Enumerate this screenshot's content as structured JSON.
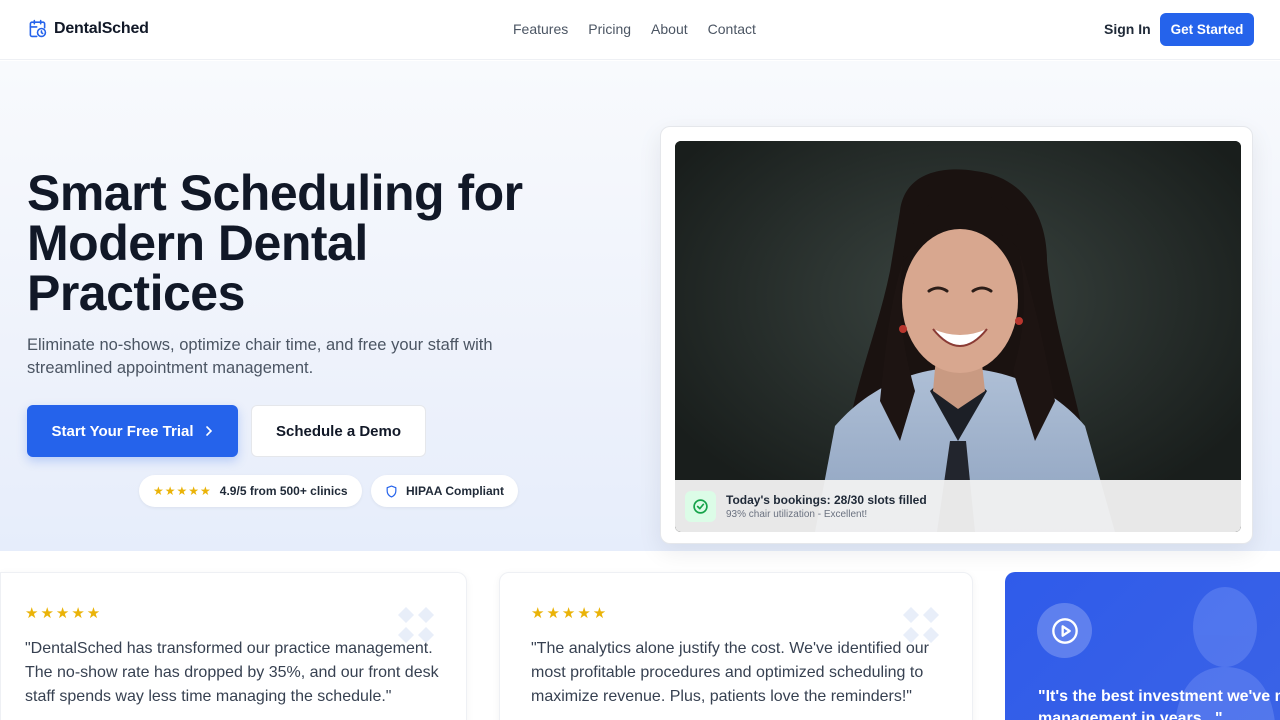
{
  "nav": {
    "brand": "DentalSched",
    "links": [
      "Features",
      "Pricing",
      "About",
      "Contact"
    ],
    "sign_in": "Sign In",
    "get_started": "Get Started"
  },
  "hero": {
    "title_lines": [
      "Smart Scheduling for",
      "Modern Dental",
      "Practices"
    ],
    "subtitle": "Eliminate no-shows, optimize chair time, and free your staff with streamlined appointment management.",
    "primary_cta": "Start Your Free Trial",
    "secondary_cta": "Schedule a Demo",
    "rating_stars": 5,
    "rating_text": "4.9/5 from 500+ clinics",
    "hipaa_text": "HIPAA Compliant"
  },
  "image_card": {
    "booking_title": "Today's bookings: 28/30 slots filled",
    "booking_sub": "93% chair utilization - Excellent!"
  },
  "testimonials": [
    {
      "stars": 5,
      "quote": "\"DentalSched has transformed our practice management. The no-show rate has dropped by 35%, and our front desk staff spends way less time managing the schedule.\""
    },
    {
      "stars": 5,
      "quote": "\"The analytics alone justify the cost. We've identified our most profitable procedures and optimized scheduling to maximize revenue. Plus, patients love the reminders!\""
    }
  ],
  "video_card": {
    "quote_line1": "\"It's the best investment we've ma",
    "quote_line2": "management in years...\""
  },
  "colors": {
    "primary": "#2563eb",
    "star": "#eab308",
    "success": "#16a34a"
  }
}
